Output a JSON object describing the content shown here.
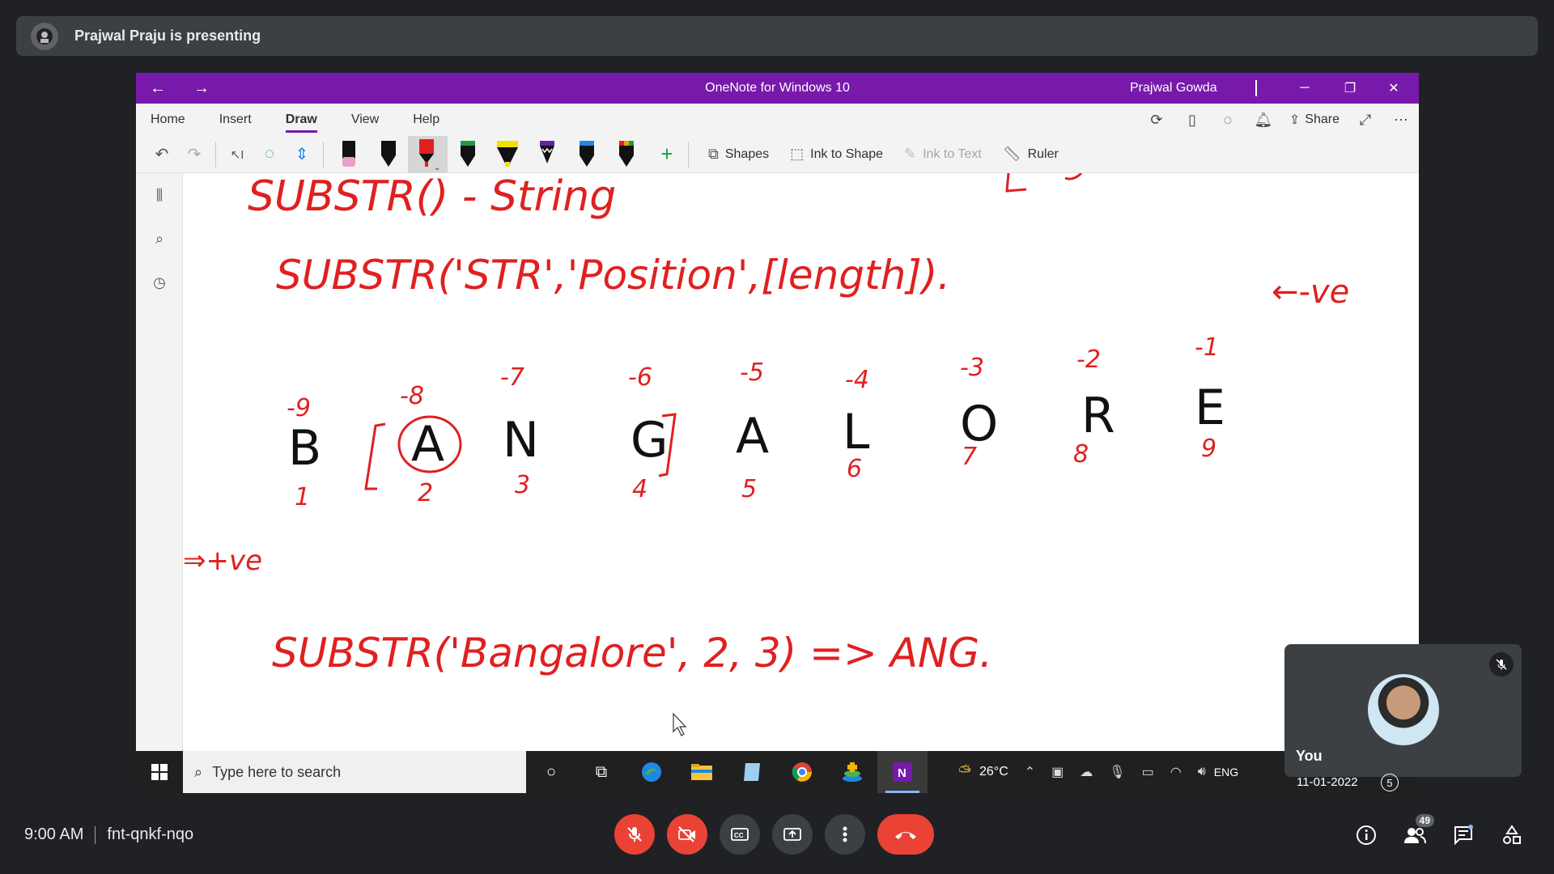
{
  "banner": {
    "presenter_text": "Prajwal Praju is presenting"
  },
  "onenote": {
    "title": "OneNote for Windows 10",
    "user": "Prajwal Gowda",
    "tabs": [
      "Home",
      "Insert",
      "Draw",
      "View",
      "Help"
    ],
    "active_tab": "Draw",
    "share_label": "Share",
    "tools": {
      "shapes": "Shapes",
      "ink_to_shape": "Ink to Shape",
      "ink_to_text": "Ink to Text",
      "ruler": "Ruler"
    },
    "pen_colors": [
      "#e8a0c8",
      "#111111",
      "#e02020",
      "#1a9e3a",
      "#f0e000",
      "#6a1fb0",
      "#1e88e5",
      "#2e7d32"
    ],
    "accent": "#7719aa"
  },
  "ink": {
    "line1": "SUBSTR() - String",
    "line2": "SUBSTR('STR','Position',[length]).",
    "direction_note": "←-ve",
    "letters": [
      "B",
      "A",
      "N",
      "G",
      "A",
      "L",
      "O",
      "R",
      "E"
    ],
    "neg_index": [
      "-9",
      "-8",
      "-7",
      "-6",
      "-5",
      "-4",
      "-3",
      "-2",
      "-1"
    ],
    "pos_index": [
      "1",
      "2",
      "3",
      "4",
      "5",
      "6",
      "7",
      "8",
      "9"
    ],
    "plus_note": "⇒+ve",
    "example": "SUBSTR('Bangalore', 2, 3) => ANG."
  },
  "taskbar": {
    "search_placeholder": "Type here to search",
    "weather": "26°C",
    "lang": "ENG",
    "date": "11-01-2022",
    "notif_count": "5"
  },
  "self_tile": {
    "name": "You"
  },
  "meet": {
    "time": "9:00 AM",
    "code": "fnt-qnkf-nqo",
    "participants": "49"
  }
}
